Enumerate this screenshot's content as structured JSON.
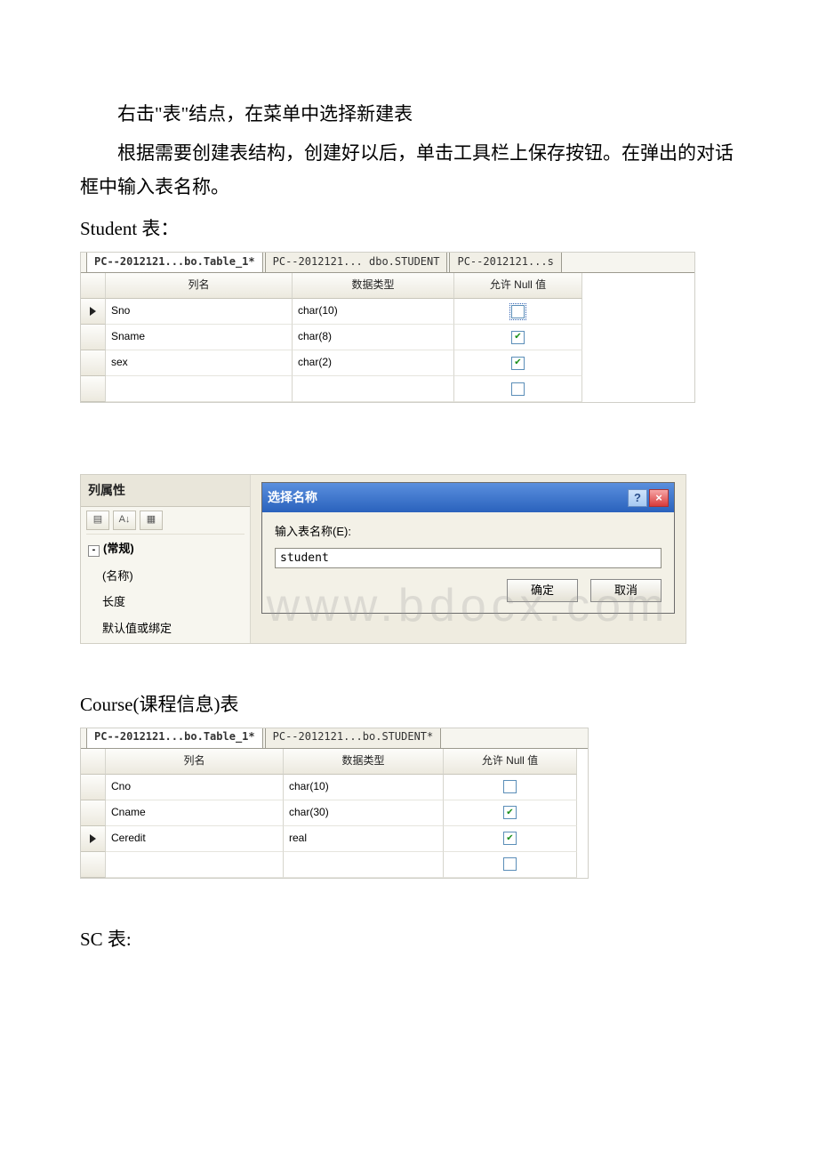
{
  "text": {
    "p1": "右击\"表\"结点，在菜单中选择新建表",
    "p2": "根据需要创建表结构，创建好以后，单击工具栏上保存按钮。在弹出的对话框中输入表名称。",
    "student_header": "Student 表：",
    "course_header": "Course(课程信息)表",
    "sc_header": "SC 表:"
  },
  "student_table": {
    "tabs": [
      "PC--2012121...bo.Table_1*",
      "PC--2012121... dbo.STUDENT",
      "PC--2012121...s"
    ],
    "active_tab": 0,
    "headers": [
      "列名",
      "数据类型",
      "允许 Null 值"
    ],
    "rows": [
      {
        "name": "Sno",
        "type": "char(10)",
        "allow_null": false,
        "selected": true,
        "focus": true
      },
      {
        "name": "Sname",
        "type": "char(8)",
        "allow_null": true,
        "selected": false,
        "focus": false
      },
      {
        "name": "sex",
        "type": "char(2)",
        "allow_null": true,
        "selected": false,
        "focus": false
      },
      {
        "name": "",
        "type": "",
        "allow_null": false,
        "selected": false,
        "focus": false
      }
    ]
  },
  "course_table": {
    "tabs": [
      "PC--2012121...bo.Table_1*",
      "PC--2012121...bo.STUDENT*"
    ],
    "active_tab": 0,
    "headers": [
      "列名",
      "数据类型",
      "允许 Null 值"
    ],
    "rows": [
      {
        "name": "Cno",
        "type": "char(10)",
        "allow_null": false,
        "selected": false
      },
      {
        "name": "Cname",
        "type": "char(30)",
        "allow_null": true,
        "selected": false
      },
      {
        "name": "Ceredit",
        "type": "real",
        "allow_null": true,
        "selected": true
      },
      {
        "name": "",
        "type": "",
        "allow_null": false,
        "selected": false
      }
    ]
  },
  "prop_pane": {
    "title": "列属性",
    "toolbar_icons": [
      "categorized-icon",
      "sort-az-icon",
      "properties-icon"
    ],
    "group": "(常规)",
    "items": [
      "(名称)",
      "长度",
      "默认值或绑定"
    ]
  },
  "dialog": {
    "title": "选择名称",
    "label": "输入表名称(E):",
    "value": "student",
    "ok": "确定",
    "cancel": "取消"
  },
  "watermark": "www.bdocx.com"
}
